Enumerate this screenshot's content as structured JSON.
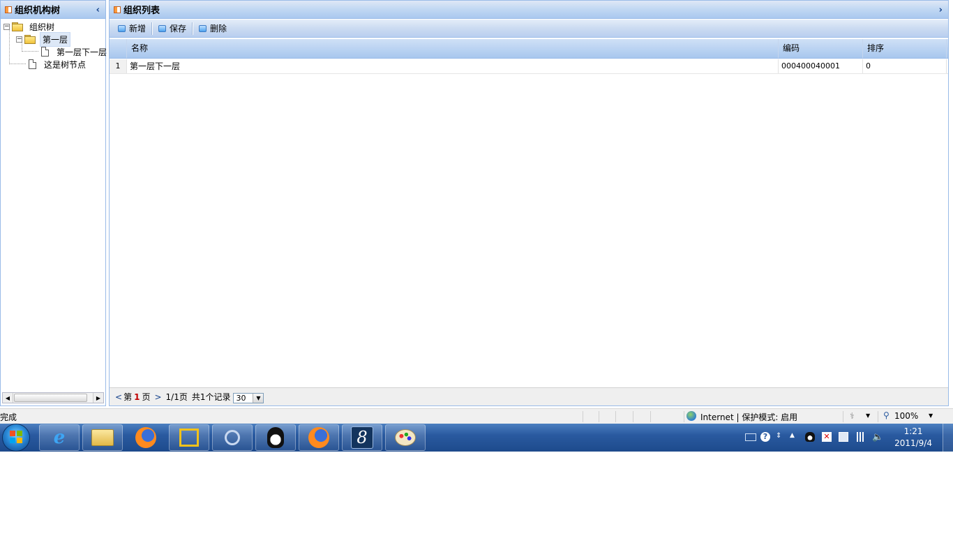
{
  "left_panel": {
    "title": "组织机构树",
    "tree": {
      "root": "组织树",
      "level1": "第一层",
      "level1_child": "第一层下一层",
      "node2": "这是树节点"
    }
  },
  "main_panel": {
    "title": "组织列表",
    "toolbar": {
      "add_label": "新增",
      "save_label": "保存",
      "delete_label": "删除"
    },
    "grid": {
      "columns": [
        "名称",
        "编码",
        "排序"
      ],
      "rows": [
        {
          "num": "1",
          "name": "第一层下一层",
          "code": "000400040001",
          "order": "0"
        }
      ]
    },
    "pager": {
      "prev": "<",
      "page_prefix": "第",
      "current_page": "1",
      "page_suffix": "页",
      "next": ">",
      "page_count": "1/1页",
      "total": "共1个记录",
      "page_size": "30"
    }
  },
  "statusbar": {
    "status_text": "完成",
    "zone": "Internet | 保护模式: 启用",
    "zoom": "100%"
  },
  "taskbar": {
    "apps": [
      "internet-explorer",
      "windows-explorer",
      "firefox",
      "vmware",
      "search-tool",
      "qq",
      "firefox",
      "app-8",
      "paint"
    ],
    "clock_time": "1:21",
    "clock_date": "2011/9/4"
  },
  "colors": {
    "panel_border": "#99bbe8",
    "header_text": "#15428b",
    "current_page": "#c00000",
    "taskbar": "#2a5aa0"
  }
}
